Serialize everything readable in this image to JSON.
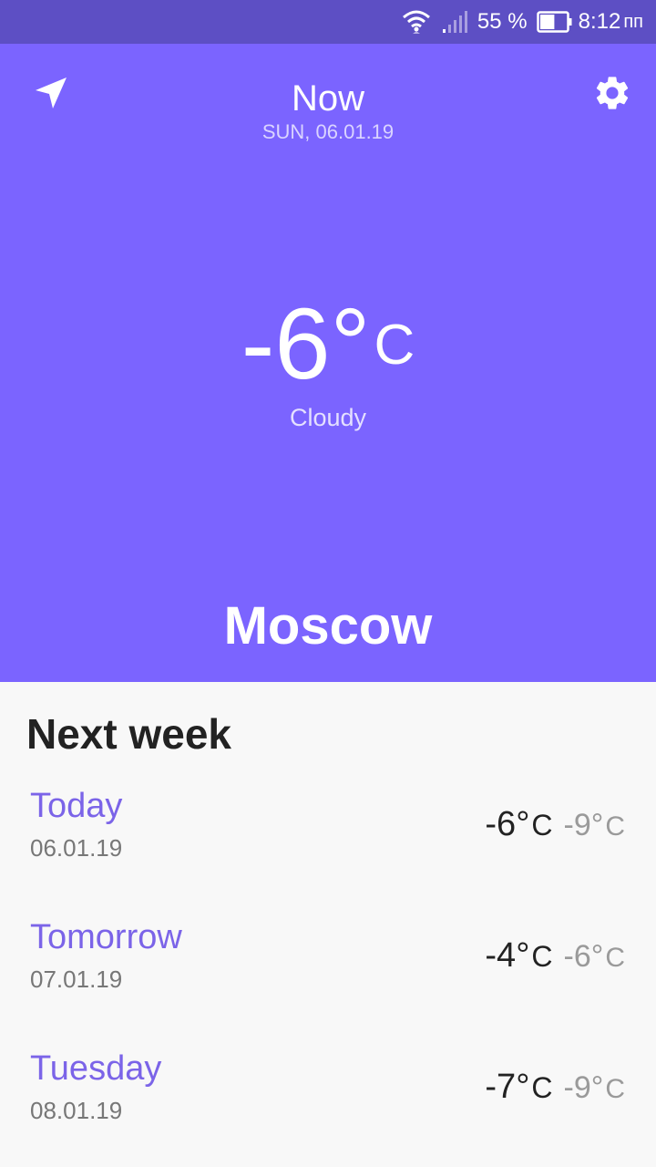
{
  "status_bar": {
    "battery_percent": "55 %",
    "battery_level": 0.55,
    "time": "8:12",
    "time_suffix": "пп"
  },
  "header": {
    "title": "Now",
    "date": "SUN, 06.01.19",
    "left_icon": "location-arrow-icon",
    "right_icon": "gear-icon"
  },
  "current": {
    "temperature": "-6°",
    "unit": "C",
    "condition": "Cloudy",
    "city": "Moscow"
  },
  "week": {
    "title": "Next week",
    "days": [
      {
        "name": "Today",
        "date": "06.01.19",
        "high": "-6°",
        "high_unit": "C",
        "low": "-9°",
        "low_unit": "C"
      },
      {
        "name": "Tomorrow",
        "date": "07.01.19",
        "high": "-4°",
        "high_unit": "C",
        "low": "-6°",
        "low_unit": "C"
      },
      {
        "name": "Tuesday",
        "date": "08.01.19",
        "high": "-7°",
        "high_unit": "C",
        "low": "-9°",
        "low_unit": "C"
      }
    ]
  },
  "colors": {
    "status_bar": "#5d4fc4",
    "primary": "#7b64ff",
    "accent_text": "#7b64e8",
    "background": "#f8f8f8"
  }
}
